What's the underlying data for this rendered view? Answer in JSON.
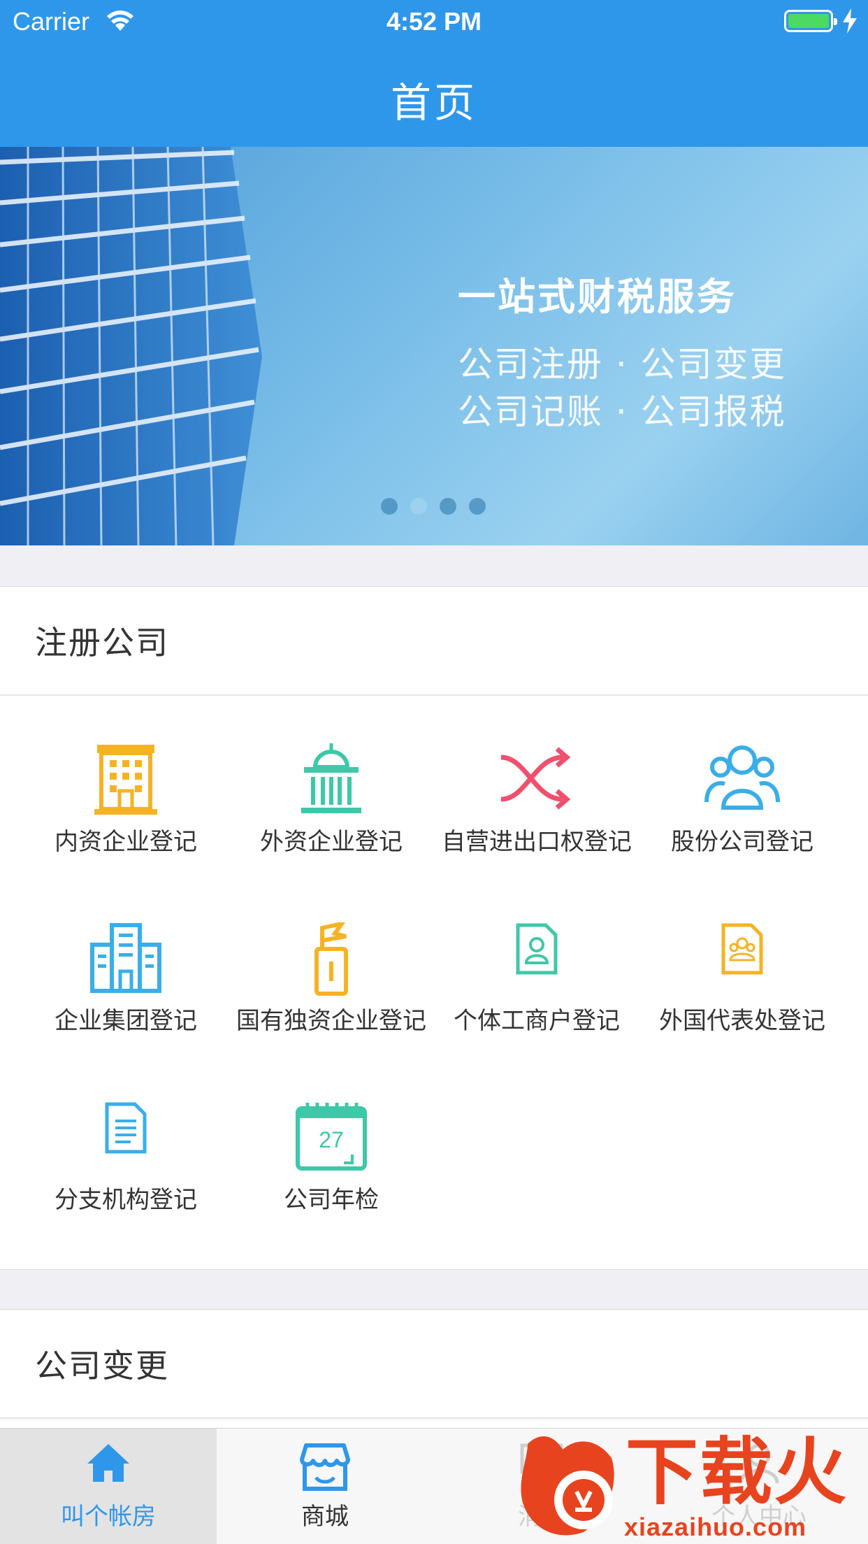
{
  "status_bar": {
    "carrier": "Carrier",
    "time": "4:52 PM"
  },
  "nav": {
    "title": "首页"
  },
  "banner": {
    "title": "一站式财税服务",
    "line1": "公司注册 · 公司变更",
    "line2": "公司记账 · 公司报税",
    "page_count": 4,
    "active_page": 2
  },
  "sections": {
    "register": {
      "title": "注册公司",
      "items": [
        {
          "label": "内资企业登记",
          "icon": "office-building-icon"
        },
        {
          "label": "外资企业登记",
          "icon": "government-building-icon"
        },
        {
          "label": "自营进出口权登记",
          "icon": "shuffle-arrows-icon"
        },
        {
          "label": "股份公司登记",
          "icon": "group-people-icon"
        },
        {
          "label": "企业集团登记",
          "icon": "city-buildings-icon"
        },
        {
          "label": "国有独资企业登记",
          "icon": "flag-tower-icon"
        },
        {
          "label": "个体工商户登记",
          "icon": "person-id-document-icon"
        },
        {
          "label": "外国代表处登记",
          "icon": "group-document-icon"
        },
        {
          "label": "分支机构登记",
          "icon": "text-document-icon"
        },
        {
          "label": "公司年检",
          "icon": "calendar-icon",
          "calendar_day": "27"
        }
      ]
    },
    "change": {
      "title": "公司变更"
    }
  },
  "tabbar": {
    "tabs": [
      {
        "label": "叫个帐房",
        "icon": "home-icon"
      },
      {
        "label": "商城",
        "icon": "store-icon"
      },
      {
        "label": "消息",
        "icon": "message-icon"
      },
      {
        "label": "个人中心",
        "icon": "profile-icon"
      }
    ],
    "active_index": 0
  },
  "watermark": {
    "text": "下载火",
    "url": "xiazaihuo.com"
  },
  "colors": {
    "nav_blue": "#2f97ea",
    "icon_orange": "#f5b324",
    "icon_teal": "#3ec8a8",
    "icon_red": "#f0506e",
    "icon_blue": "#3aaee8",
    "watermark_red": "#e8431f"
  }
}
